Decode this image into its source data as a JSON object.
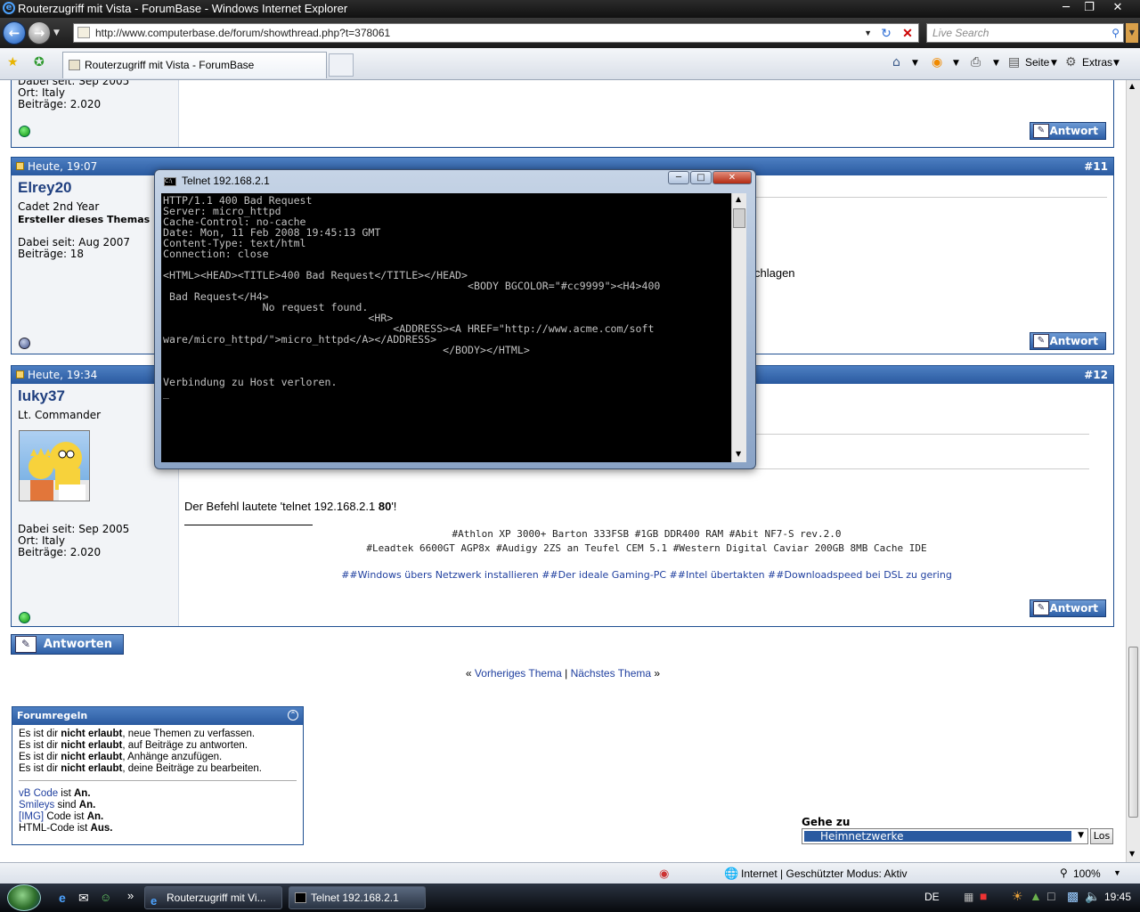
{
  "window": {
    "title": "Routerzugriff mit Vista - ForumBase - Windows Internet Explorer"
  },
  "address_bar": {
    "url": "http://www.computerbase.de/forum/showthread.php?t=378061"
  },
  "search": {
    "placeholder": "Live Search"
  },
  "tab": {
    "label": "Routerzugriff mit Vista - ForumBase"
  },
  "toolbar": {
    "page_label": "Seite",
    "tools_label": "Extras"
  },
  "post_prev": {
    "dabei": "Dabei seit: Sep 2005",
    "ort": "Ort: Italy",
    "beitraege": "Beiträge: 2.020",
    "reply_label": "Antwort"
  },
  "post11": {
    "date": "Heute, 19:07",
    "number": "#11",
    "username": "Elrey20",
    "user_title": "Cadet 2nd Year",
    "creator": "Ersteller dieses Themas",
    "dabei": "Dabei seit: Aug 2007",
    "beitraege": "Beiträge: 18",
    "text_fragment": "chlagen",
    "reply_label": "Antwort"
  },
  "post12": {
    "date": "Heute, 19:34",
    "number": "#12",
    "username": "luky37",
    "user_title": "Lt. Commander",
    "dabei": "Dabei seit: Sep 2005",
    "ort": "Ort: Italy",
    "beitraege": "Beiträge: 2.020",
    "message_prefix": "Der Befehl lautete 'telnet 192.168.2.1 ",
    "message_bold": "80",
    "message_suffix": "'!",
    "sig_line1": "#Athlon XP 3000+ Barton 333FSB #1GB DDR400 RAM #Abit NF7-S rev.2.0",
    "sig_line2": "#Leadtek 6600GT AGP8x #Audigy 2ZS an Teufel CEM 5.1 #Western Digital Caviar 200GB 8MB Cache IDE",
    "links": [
      {
        "prefix": "##",
        "label": "Windows übers Netzwerk installieren"
      },
      {
        "prefix": " ##",
        "label": "Der ideale Gaming-PC"
      },
      {
        "prefix": " ##",
        "label": "Intel übertakten"
      },
      {
        "prefix": " ##",
        "label": "Downloadspeed bei DSL zu gering"
      }
    ],
    "reply_label": "Antwort"
  },
  "answer_button": {
    "label": "Antworten"
  },
  "thread_nav": {
    "prev": "Vorheriges Thema",
    "sep": "|",
    "next": "Nächstes Thema",
    "left_quote": "«",
    "right_quote": "»"
  },
  "forum_rules": {
    "title": "Forumregeln",
    "rules": [
      {
        "a": "Es ist dir ",
        "b": "nicht erlaubt",
        "c": ", neue Themen zu verfassen."
      },
      {
        "a": "Es ist dir ",
        "b": "nicht erlaubt",
        "c": ", auf Beiträge zu antworten."
      },
      {
        "a": "Es ist dir ",
        "b": "nicht erlaubt",
        "c": ", Anhänge anzufügen."
      },
      {
        "a": "Es ist dir ",
        "b": "nicht erlaubt",
        "c": ", deine Beiträge zu bearbeiten."
      }
    ],
    "codes": [
      {
        "link": "vB Code",
        "mid": " ist ",
        "val": "An."
      },
      {
        "link": "Smileys",
        "mid": " sind ",
        "val": "An."
      },
      {
        "link": "[IMG]",
        "mid": " Code ist ",
        "val": "An."
      },
      {
        "link": "",
        "mid": "HTML-Code ist ",
        "val": "Aus."
      }
    ]
  },
  "goto": {
    "label": "Gehe zu",
    "selected": "Heimnetzwerke",
    "button": "Los"
  },
  "telnet": {
    "title": "Telnet 192.168.2.1",
    "lines": [
      "HTTP/1.1 400 Bad Request",
      "Server: micro_httpd",
      "Cache-Control: no-cache",
      "Date: Mon, 11 Feb 2008 19:45:13 GMT",
      "Content-Type: text/html",
      "Connection: close",
      "",
      "<HTML><HEAD><TITLE>400 Bad Request</TITLE></HEAD>",
      "                                                 <BODY BGCOLOR=\"#cc9999\"><H4>400",
      " Bad Request</H4>",
      "                No request found.",
      "                                 <HR>",
      "                                     <ADDRESS><A HREF=\"http://www.acme.com/soft",
      "ware/micro_httpd/\">micro_httpd</A></ADDRESS>",
      "                                             </BODY></HTML>",
      "",
      "",
      "Verbindung zu Host verloren.",
      "_"
    ]
  },
  "statusbar": {
    "zone": "Internet | Geschützter Modus: Aktiv",
    "zoom": "100%"
  },
  "taskbar": {
    "tasks": [
      "Routerzugriff mit Vi...",
      "Telnet 192.168.2.1"
    ],
    "lang": "DE",
    "clock": "19:45",
    "chevron": "»"
  },
  "colors": {
    "header_blue": "#2a5aa0",
    "link_blue": "#1f3f9f",
    "online_green": "#0b8f0b"
  }
}
